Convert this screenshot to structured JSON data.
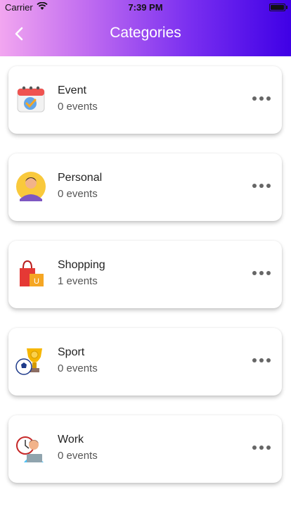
{
  "status_bar": {
    "carrier": "Carrier",
    "time": "7:39 PM"
  },
  "header": {
    "title": "Categories",
    "back_icon": "chevron-left-icon"
  },
  "categories": [
    {
      "name": "Event",
      "count": "0 events",
      "icon": "calendar-icon"
    },
    {
      "name": "Personal",
      "count": "0 events",
      "icon": "person-avatar-icon"
    },
    {
      "name": "Shopping",
      "count": "1 events",
      "icon": "shopping-bag-icon"
    },
    {
      "name": "Sport",
      "count": "0 events",
      "icon": "trophy-ball-icon"
    },
    {
      "name": "Work",
      "count": "0 events",
      "icon": "worker-laptop-icon"
    }
  ],
  "colors": {
    "header_gradient": [
      "#f2a6f0",
      "#3f00e6"
    ],
    "title": "#ffffff",
    "card_bg": "#ffffff"
  }
}
